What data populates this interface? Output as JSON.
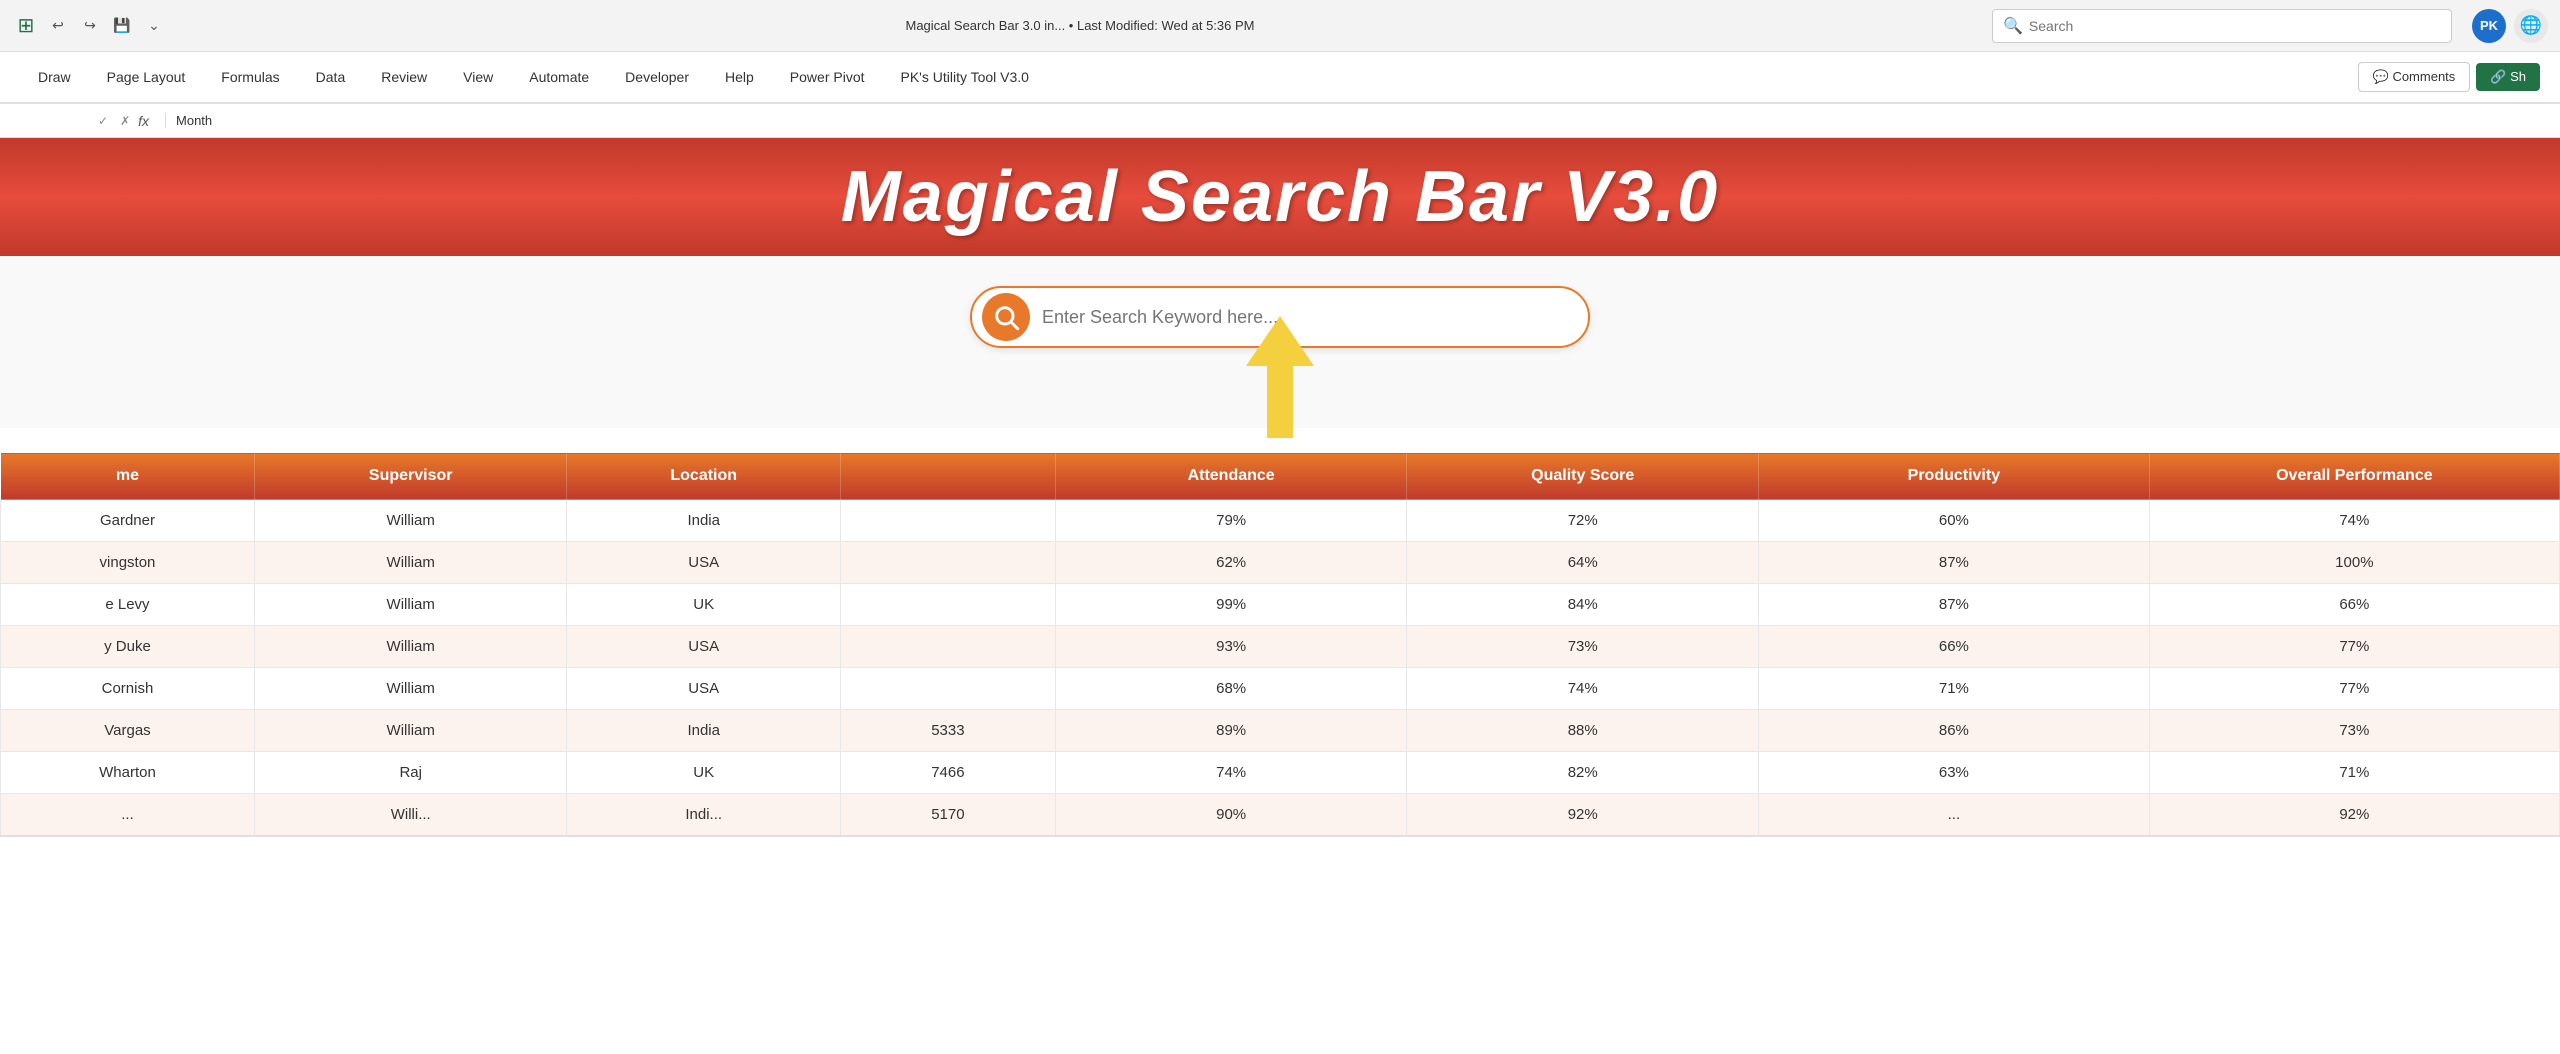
{
  "titlebar": {
    "title": "Magical Search Bar 3.0 in... • Last Modified: Wed at 5:36 PM",
    "search_placeholder": "Search",
    "user_initials": "PK",
    "dropdown_arrow": "▾"
  },
  "ribbon": {
    "tabs": [
      "Draw",
      "Page Layout",
      "Formulas",
      "Data",
      "Review",
      "View",
      "Automate",
      "Developer",
      "Help",
      "Power Pivot",
      "PK's Utility Tool V3.0"
    ],
    "comments_label": "💬 Comments",
    "share_label": "🔗 Sh"
  },
  "formulabar": {
    "cell_ref": "",
    "fx_label": "fx",
    "value": "Month"
  },
  "banner": {
    "title": "Magical Search Bar V3.0"
  },
  "search": {
    "placeholder": "Enter Search Keyword here..."
  },
  "table": {
    "headers": [
      "me",
      "Supervisor",
      "Location",
      "",
      "Attendance",
      "Quality Score",
      "Productivity",
      "Overall Performance"
    ],
    "rows": [
      {
        "name": "Gardner",
        "supervisor": "William",
        "location": "India",
        "salary": "",
        "attendance": "79%",
        "quality": "72%",
        "productivity": "60%",
        "overall": "74%"
      },
      {
        "name": "vingston",
        "supervisor": "William",
        "location": "USA",
        "salary": "",
        "attendance": "62%",
        "quality": "64%",
        "productivity": "87%",
        "overall": "100%"
      },
      {
        "name": "e Levy",
        "supervisor": "William",
        "location": "UK",
        "salary": "",
        "attendance": "99%",
        "quality": "84%",
        "productivity": "87%",
        "overall": "66%"
      },
      {
        "name": "y Duke",
        "supervisor": "William",
        "location": "USA",
        "salary": "",
        "attendance": "93%",
        "quality": "73%",
        "productivity": "66%",
        "overall": "77%"
      },
      {
        "name": "Cornish",
        "supervisor": "William",
        "location": "USA",
        "salary": "",
        "attendance": "68%",
        "quality": "74%",
        "productivity": "71%",
        "overall": "77%"
      },
      {
        "name": "Vargas",
        "supervisor": "William",
        "location": "India",
        "salary": "5333",
        "attendance": "89%",
        "quality": "88%",
        "productivity": "86%",
        "overall": "73%"
      },
      {
        "name": "Wharton",
        "supervisor": "Raj",
        "location": "UK",
        "salary": "7466",
        "attendance": "74%",
        "quality": "82%",
        "productivity": "63%",
        "overall": "71%"
      },
      {
        "name": "...",
        "supervisor": "Willi...",
        "location": "Indi...",
        "salary": "5170",
        "attendance": "90%",
        "quality": "92%",
        "productivity": "...",
        "overall": "92%"
      }
    ]
  },
  "icons": {
    "search": "🔍",
    "undo": "↩",
    "redo": "↪",
    "save": "💾",
    "more": "⌄",
    "formula": "fx",
    "comment": "💬",
    "share": "⬆"
  }
}
